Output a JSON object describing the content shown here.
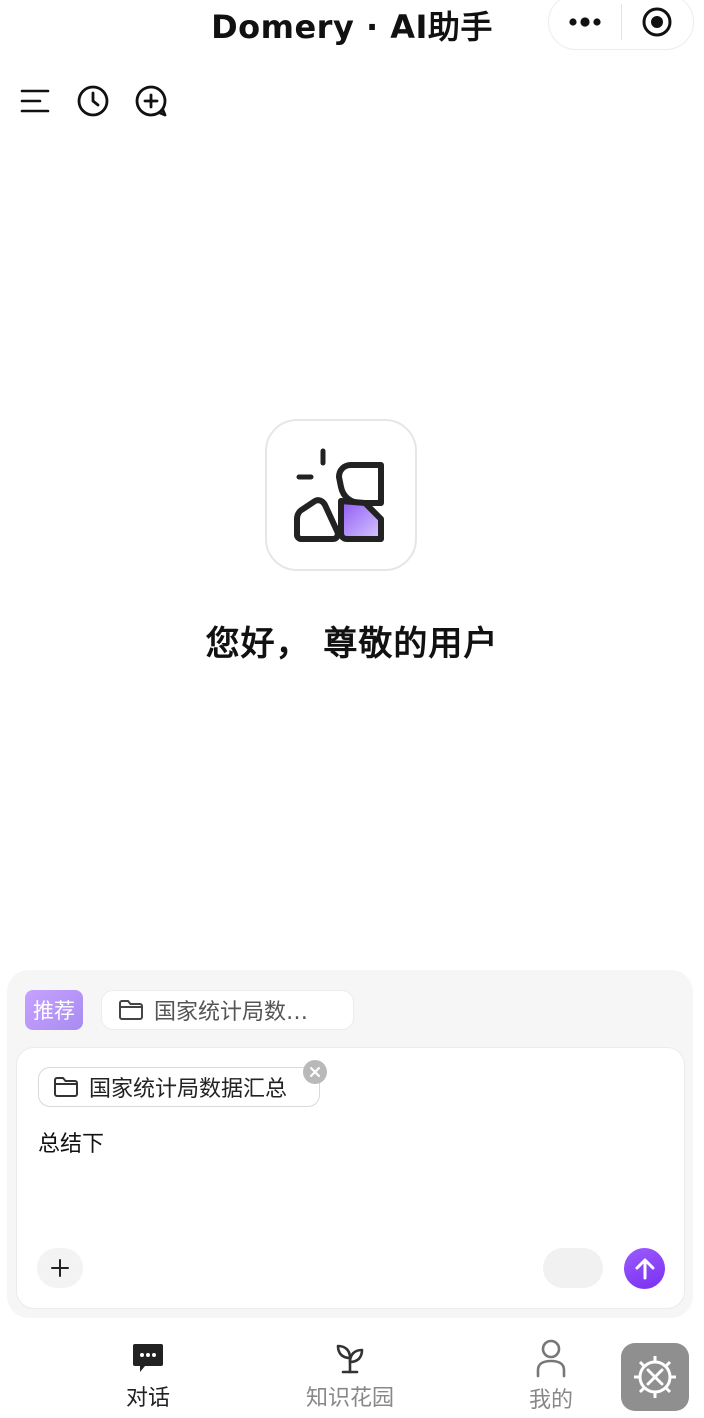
{
  "header": {
    "title": "Domery · AI助手"
  },
  "main": {
    "greeting": "您好， 尊敬的用户"
  },
  "composer": {
    "recommend_label": "推荐",
    "recommend_item": "国家统计局数…",
    "attached_folder": "国家统计局数据汇总",
    "message": "总结下"
  },
  "tabs": [
    {
      "label": "对话",
      "icon": "chat-icon",
      "active": true
    },
    {
      "label": "知识花园",
      "icon": "sprout-icon",
      "active": false
    },
    {
      "label": "我的",
      "icon": "user-icon",
      "active": false
    }
  ],
  "colors": {
    "accent": "#8a3ffc",
    "accent_light": "#c6a2ff",
    "text": "#111111",
    "muted": "#888888"
  }
}
